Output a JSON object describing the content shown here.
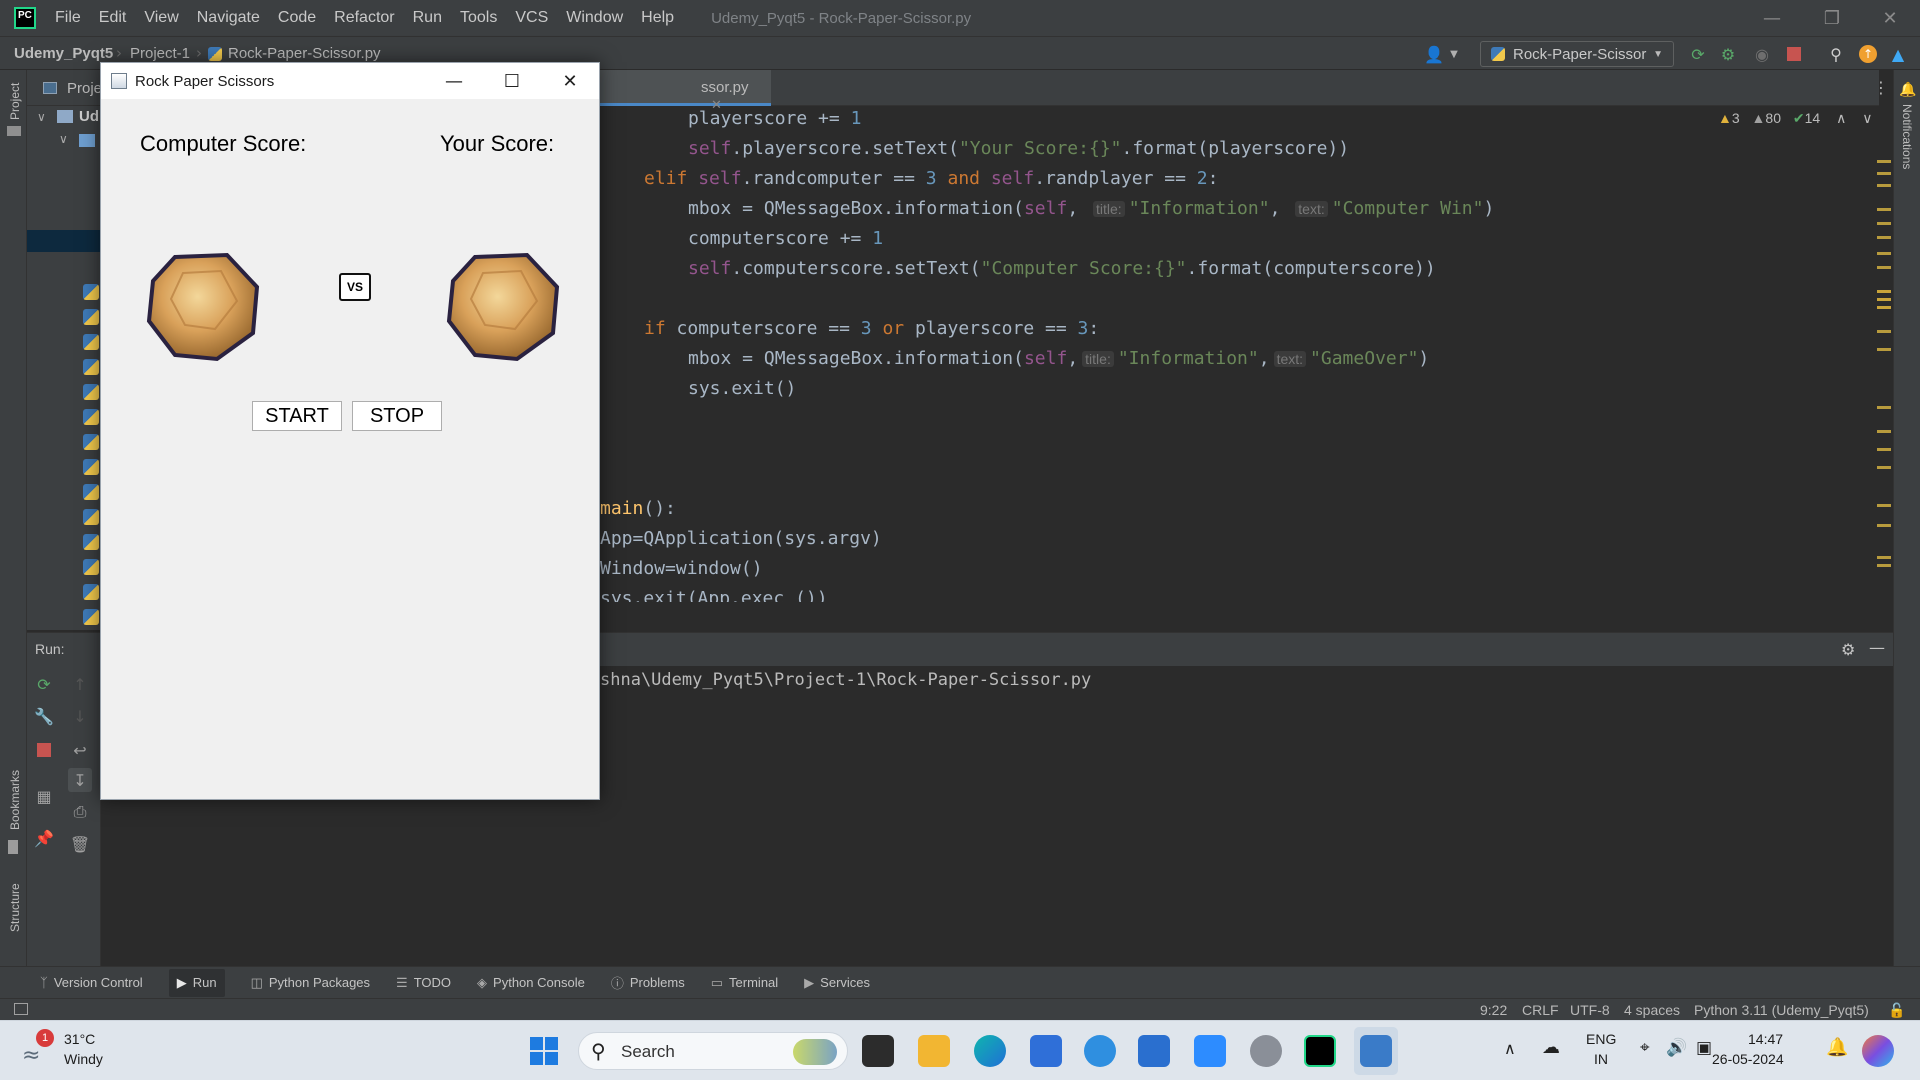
{
  "menubar": {
    "items": [
      "File",
      "Edit",
      "View",
      "Navigate",
      "Code",
      "Refactor",
      "Run",
      "Tools",
      "VCS",
      "Window",
      "Help"
    ],
    "window_title": "Udemy_Pyqt5 - Rock-Paper-Scissor.py"
  },
  "navbar": {
    "breadcrumb": [
      "Udemy_Pyqt5",
      "Project-1",
      "Rock-Paper-Scissor.py"
    ],
    "run_config": "Rock-Paper-Scissor"
  },
  "left_stripe": {
    "project": "Project",
    "bookmarks": "Bookmarks",
    "structure": "Structure"
  },
  "project_panel": {
    "tab_label": "Proje",
    "root_label": "Ud"
  },
  "editor": {
    "tab_label": "ssor.py",
    "inspections": {
      "warnings": "3",
      "weak_warnings": "80",
      "typos": "14"
    },
    "hints": {
      "title": "title:",
      "text": "text:"
    }
  },
  "run_panel": {
    "label": "Run:",
    "output_path": "shna\\Udemy_Pyqt5\\Project-1\\Rock-Paper-Scissor.py"
  },
  "bottom_tools": [
    {
      "icon": "version-control-icon",
      "label": "Version Control"
    },
    {
      "icon": "run-icon",
      "label": "Run"
    },
    {
      "icon": "python-packages-icon",
      "label": "Python Packages"
    },
    {
      "icon": "todo-icon",
      "label": "TODO"
    },
    {
      "icon": "python-console-icon",
      "label": "Python Console"
    },
    {
      "icon": "problems-icon",
      "label": "Problems"
    },
    {
      "icon": "terminal-icon",
      "label": "Terminal"
    },
    {
      "icon": "services-icon",
      "label": "Services"
    }
  ],
  "statusbar": {
    "position": "9:22",
    "line_sep": "CRLF",
    "encoding": "UTF-8",
    "indent": "4 spaces",
    "interpreter": "Python 3.11 (Udemy_Pyqt5)"
  },
  "taskbar": {
    "weather_temp": "31°C",
    "weather_desc": "Windy",
    "weather_badge": "1",
    "search_placeholder": "Search",
    "lang_top": "ENG",
    "lang_bottom": "IN",
    "time": "14:47",
    "date": "26-05-2024"
  },
  "dialog": {
    "title": "Rock Paper Scissors",
    "computer_score_label": "Computer Score:",
    "your_score_label": "Your Score:",
    "vs_label": "VS",
    "start_label": "START",
    "stop_label": "STOP"
  },
  "colors": {
    "accent": "#4a88c7",
    "keyword": "#cc7832",
    "string": "#6a8759",
    "number": "#6897bb",
    "self": "#94558d"
  }
}
